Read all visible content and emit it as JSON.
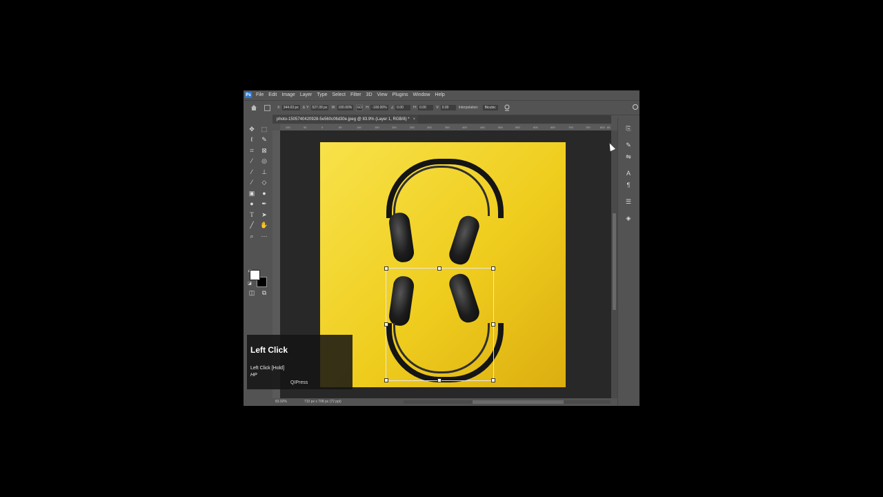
{
  "app": {
    "logo_text": "Ps"
  },
  "menu": [
    "File",
    "Edit",
    "Image",
    "Layer",
    "Type",
    "Select",
    "Filter",
    "3D",
    "View",
    "Plugins",
    "Window",
    "Help"
  ],
  "options_bar": {
    "x_label": "X:",
    "x_value": "344.03 px",
    "y_label": "Y:",
    "y_value": "527.09 px",
    "w_label": "W:",
    "w_value": "100.00%",
    "link_text": "GO",
    "h_label": "H:",
    "h_value": "-100.00%",
    "angle_value": "0.00",
    "hskew_label": "H:",
    "hskew_value": "0.00",
    "vskew_label": "V:",
    "vskew_value": "0.00",
    "interp_label": "Interpolation:",
    "interp_value": "Bicubic"
  },
  "document": {
    "tab_title": "photo-1505740420928-5e560c06d30e.jpeg @ 83.9% (Layer 1, RGB/8) *",
    "close_glyph": "×"
  },
  "ruler_marks": [
    "100",
    "50",
    "0",
    "50",
    "100",
    "150",
    "200",
    "250",
    "300",
    "350",
    "400",
    "450",
    "500",
    "550",
    "600",
    "650",
    "700",
    "750",
    "800",
    "85"
  ],
  "status": {
    "zoom": "83.92%",
    "dims": "710 px x 708 px (72 ppi)"
  },
  "overlay": {
    "title": "Left Click",
    "line1": "Left Click [Hold]",
    "line2": "HP",
    "line3": "QIPress"
  },
  "icons": {
    "home": "home-icon",
    "cancel": "cancel-icon",
    "tools": [
      "move-icon",
      "marquee-icon",
      "lasso-icon",
      "quick-select-icon",
      "crop-icon",
      "frame-icon",
      "eyedropper-icon",
      "patch-icon",
      "brush-icon",
      "stamp-icon",
      "history-brush-icon",
      "eraser-icon",
      "gradient-icon",
      "blur-icon",
      "dodge-icon",
      "pen-icon",
      "type-icon",
      "path-select-icon",
      "line-icon",
      "hand-icon",
      "zoom-icon",
      "more-icon",
      "quick-mask-icon",
      "screen-mode-icon"
    ],
    "panels": [
      "history-icon",
      "brush-settings-icon",
      "adjustments-icon",
      "character-icon",
      "paragraph-icon",
      "properties-icon",
      "layers-icon"
    ]
  },
  "colors": {
    "foreground": "#ffffff",
    "background": "#000000",
    "photo_bg": "#f2d422"
  }
}
